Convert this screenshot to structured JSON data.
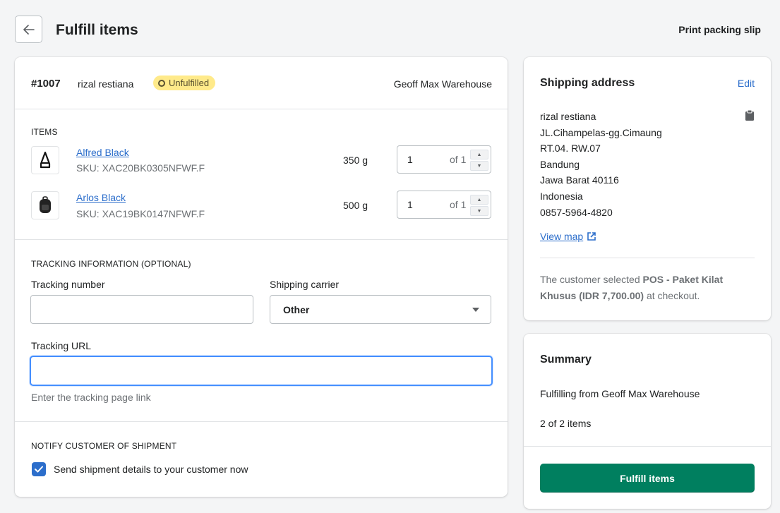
{
  "header": {
    "title": "Fulfill items",
    "print_label": "Print packing slip"
  },
  "order": {
    "number": "#1007",
    "customer": "rizal restiana",
    "status": "Unfulfilled",
    "location": "Geoff Max Warehouse"
  },
  "items_section": {
    "heading": "ITEMS",
    "items": [
      {
        "name": "Alfred Black",
        "sku": "SKU: XAC20BK0305NFWF.F",
        "weight": "350 g",
        "qty": "1",
        "of": "of 1",
        "icon": "bag-icon"
      },
      {
        "name": "Arlos Black",
        "sku": "SKU: XAC19BK0147NFWF.F",
        "weight": "500 g",
        "qty": "1",
        "of": "of 1",
        "icon": "backpack-icon"
      }
    ]
  },
  "tracking": {
    "heading": "TRACKING INFORMATION (OPTIONAL)",
    "number_label": "Tracking number",
    "number_value": "",
    "carrier_label": "Shipping carrier",
    "carrier_value": "Other",
    "url_label": "Tracking URL",
    "url_value": "",
    "url_help": "Enter the tracking page link"
  },
  "notify": {
    "heading": "NOTIFY CUSTOMER OF SHIPMENT",
    "checkbox_label": "Send shipment details to your customer now",
    "checked": true
  },
  "shipping": {
    "title": "Shipping address",
    "edit_label": "Edit",
    "address_lines": [
      "rizal restiana",
      "JL.Cihampelas-gg.Cimaung",
      "RT.04. RW.07",
      "Bandung",
      "Jawa Barat 40116",
      "Indonesia",
      "0857-5964-4820"
    ],
    "view_map": "View map",
    "note_prefix": "The customer selected ",
    "note_bold": "POS - Paket Kilat Khusus (IDR 7,700.00)",
    "note_suffix": " at checkout."
  },
  "summary": {
    "title": "Summary",
    "from_text": "Fulfilling from Geoff Max Warehouse",
    "count_text": "2 of 2 items",
    "button_label": "Fulfill items"
  },
  "colors": {
    "primary": "#007f5f",
    "link": "#2c6ecb",
    "badge": "#ffea8a",
    "focus": "#458fff"
  }
}
